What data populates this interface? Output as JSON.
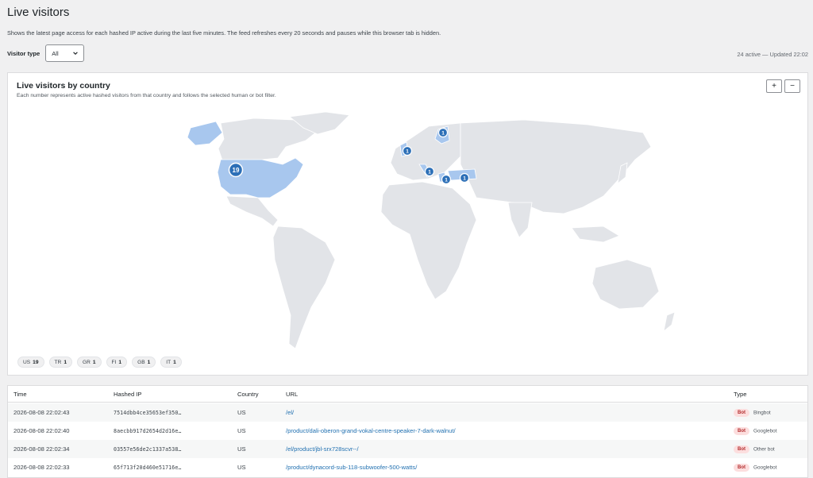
{
  "page": {
    "title": "Live visitors",
    "description": "Shows the latest page access for each hashed IP active during the last five minutes. The feed refreshes every 20 seconds and pauses while this browser tab is hidden."
  },
  "filter": {
    "label": "Visitor type",
    "selected": "All"
  },
  "status": "24 active — Updated 22:02",
  "map": {
    "title": "Live visitors by country",
    "subtitle": "Each number represents active hashed visitors from that country and follows the selected human or bot filter.",
    "zoom_in": "+",
    "zoom_out": "−",
    "markers": [
      {
        "country": "US",
        "count": "19"
      },
      {
        "country": "FI",
        "count": "1"
      },
      {
        "country": "GB",
        "count": "1"
      },
      {
        "country": "IT",
        "count": "1"
      },
      {
        "country": "GR",
        "count": "1"
      },
      {
        "country": "TR",
        "count": "1"
      }
    ],
    "highlight_color": "#a8c7ee",
    "land_color": "#e2e4e8",
    "marker_color": "#2c6fb7"
  },
  "chips": [
    {
      "code": "US",
      "count": "19"
    },
    {
      "code": "TR",
      "count": "1"
    },
    {
      "code": "GR",
      "count": "1"
    },
    {
      "code": "FI",
      "count": "1"
    },
    {
      "code": "GB",
      "count": "1"
    },
    {
      "code": "IT",
      "count": "1"
    }
  ],
  "table": {
    "headers": {
      "time": "Time",
      "hash": "Hashed IP",
      "country": "Country",
      "url": "URL",
      "type": "Type"
    },
    "rows": [
      {
        "time": "2026-08-08 22:02:43",
        "hash": "7514dbb4ce35653ef350…",
        "country": "US",
        "url": "/el/",
        "badge": "Bot",
        "bot": "Bingbot"
      },
      {
        "time": "2026-08-08 22:02:40",
        "hash": "8aecbb917d2654d2d16e…",
        "country": "US",
        "url": "/product/dali-oberon-grand-vokal-centre-speaker-7-dark-walnut/",
        "badge": "Bot",
        "bot": "Googlebot"
      },
      {
        "time": "2026-08-08 22:02:34",
        "hash": "03557e56de2c1337a538…",
        "country": "US",
        "url": "/el/product/jbl-srx728scvr--/",
        "badge": "Bot",
        "bot": "Other bot"
      },
      {
        "time": "2026-08-08 22:02:33",
        "hash": "65f713f20d460e51716e…",
        "country": "US",
        "url": "/product/dynacord-sub-118-subwoofer-500-watts/",
        "badge": "Bot",
        "bot": "Googlebot"
      }
    ]
  }
}
